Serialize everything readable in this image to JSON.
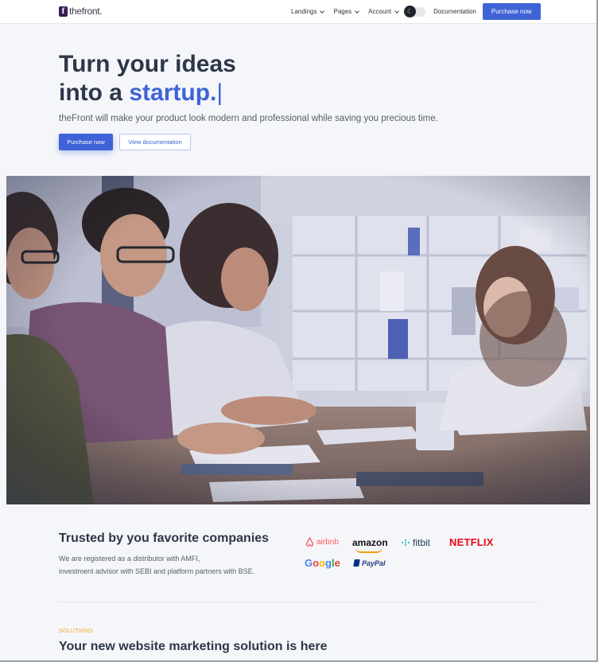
{
  "header": {
    "logo_mark": "f",
    "logo_text": "thefront.",
    "nav": [
      {
        "label": "Landings"
      },
      {
        "label": "Pages"
      },
      {
        "label": "Account"
      }
    ],
    "documentation_label": "Documentation",
    "purchase_label": "Purchase now",
    "theme_toggle_icon": "moon-icon"
  },
  "hero": {
    "title_line1": "Turn your ideas",
    "title_line2_prefix": "into a ",
    "title_accent": "startup.",
    "title_caret": "|",
    "subtitle": "theFront will make your product look modern and professional while saving you precious time.",
    "primary_button": "Purchase now",
    "secondary_button": "View documentation"
  },
  "trusted": {
    "title": "Trusted by you favorite companies",
    "description_line1": "We are registered as a distributor with AMFI,",
    "description_line2": "investment advisor with SEBI and platform partners with BSE.",
    "logos": [
      "airbnb",
      "amazon",
      "fitbit",
      "NETFLIX",
      "Google",
      "PayPal"
    ]
  },
  "solutions": {
    "label": "SOLUTIONS",
    "title": "Your new website marketing solution is here"
  },
  "colors": {
    "accent": "#3f63d6",
    "background": "#f5f6fa",
    "heading": "#2d3748",
    "solutions_label": "#f5a524"
  }
}
